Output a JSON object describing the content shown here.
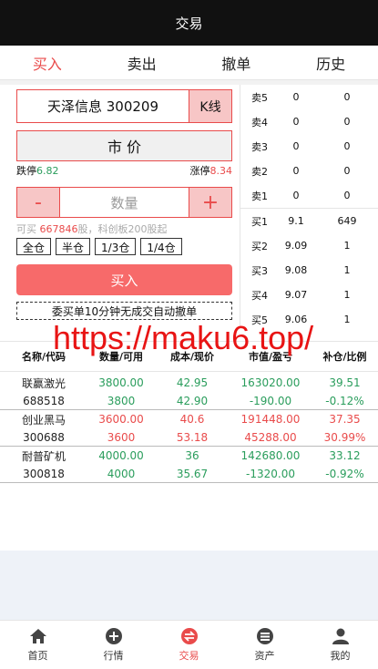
{
  "header": {
    "title": "交易"
  },
  "tabs": [
    {
      "label": "买入",
      "active": true
    },
    {
      "label": "卖出"
    },
    {
      "label": "撤单"
    },
    {
      "label": "历史"
    }
  ],
  "order": {
    "stock": "天泽信息 300209",
    "kline_label": "K线",
    "price_mode": "市 价",
    "limit_down_label": "跌停",
    "limit_down": "6.82",
    "limit_up_label": "涨停",
    "limit_up": "8.34",
    "minus": "-",
    "plus": "+",
    "qty_placeholder": "数量",
    "avail_prefix": "可买 ",
    "avail_count": "667846",
    "avail_suffix": "股，科创板200股起",
    "ratios": [
      "全仓",
      "半仓",
      "1/3仓",
      "1/4仓"
    ],
    "buy_label": "买入",
    "notice": "委买单10分钟无成交自动撤单"
  },
  "orderbook": {
    "asks": [
      {
        "label": "卖5",
        "price": "0",
        "vol": "0"
      },
      {
        "label": "卖4",
        "price": "0",
        "vol": "0"
      },
      {
        "label": "卖3",
        "price": "0",
        "vol": "0"
      },
      {
        "label": "卖2",
        "price": "0",
        "vol": "0"
      },
      {
        "label": "卖1",
        "price": "0",
        "vol": "0"
      }
    ],
    "bids": [
      {
        "label": "买1",
        "price": "9.1",
        "vol": "649"
      },
      {
        "label": "买2",
        "price": "9.09",
        "vol": "1"
      },
      {
        "label": "买3",
        "price": "9.08",
        "vol": "1"
      },
      {
        "label": "买4",
        "price": "9.07",
        "vol": "1"
      },
      {
        "label": "买5",
        "price": "9.06",
        "vol": "1"
      }
    ]
  },
  "watermark": "https://maku6.top/",
  "positions": {
    "headers": [
      "名称/代码",
      "数量/可用",
      "成本/现价",
      "市值/盈亏",
      "补仓/比例"
    ],
    "rows": [
      {
        "name": "联赢激光",
        "code": "688518",
        "qty": "3800.00",
        "avail": "3800",
        "cost": "42.95",
        "price": "42.90",
        "value": "163020.00",
        "pnl": "-190.00",
        "add": "39.51",
        "ratio": "-0.12%",
        "tone": "green"
      },
      {
        "name": "创业黑马",
        "code": "300688",
        "qty": "3600.00",
        "avail": "3600",
        "cost": "40.6",
        "price": "53.18",
        "value": "191448.00",
        "pnl": "45288.00",
        "add": "37.35",
        "ratio": "30.99%",
        "tone": "red"
      },
      {
        "name": "耐普矿机",
        "code": "300818",
        "qty": "4000.00",
        "avail": "4000",
        "cost": "36",
        "price": "35.67",
        "value": "142680.00",
        "pnl": "-1320.00",
        "add": "33.12",
        "ratio": "-0.92%",
        "tone": "green"
      }
    ]
  },
  "nav": [
    {
      "label": "首页",
      "icon": "home-icon"
    },
    {
      "label": "行情",
      "icon": "plus-circle-icon"
    },
    {
      "label": "交易",
      "icon": "trade-icon",
      "active": true
    },
    {
      "label": "资产",
      "icon": "wallet-icon"
    },
    {
      "label": "我的",
      "icon": "user-icon"
    }
  ]
}
